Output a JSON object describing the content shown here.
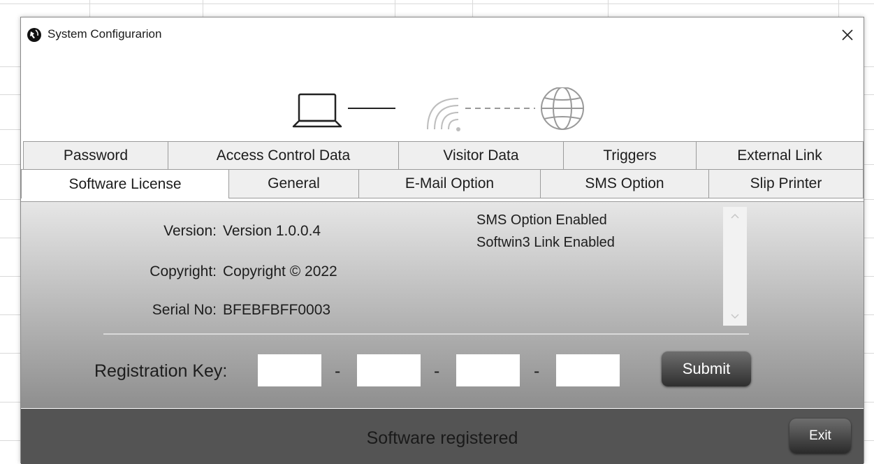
{
  "window": {
    "title": "System Configurarion",
    "icon": "globe-cursor-icon",
    "close_glyph": "✕"
  },
  "tabs_row1": [
    {
      "label": "Password"
    },
    {
      "label": "Access Control Data"
    },
    {
      "label": "Visitor Data"
    },
    {
      "label": "Triggers"
    },
    {
      "label": "External Link"
    }
  ],
  "tabs_row2": [
    {
      "label": "Software License",
      "active": true
    },
    {
      "label": "General"
    },
    {
      "label": "E-Mail Option"
    },
    {
      "label": "SMS Option"
    },
    {
      "label": "Slip Printer"
    }
  ],
  "license": {
    "version_label": "Version:",
    "version_value": "Version 1.0.0.4",
    "copyright_label": "Copyright:",
    "copyright_value": "Copyright ©  2022",
    "serial_label": "Serial No:",
    "serial_value": "BFEBFBFF0003",
    "options": [
      "SMS Option Enabled",
      "Softwin3 Link Enabled"
    ]
  },
  "registration": {
    "label": "Registration Key:",
    "separator": "-",
    "fields": [
      "",
      "",
      "",
      ""
    ],
    "submit_label": "Submit"
  },
  "status": {
    "text": "Software registered",
    "exit_label": "Exit"
  },
  "icons": [
    "laptop-icon",
    "wifi-icon",
    "globe-icon",
    "close-icon",
    "scroll-up-icon",
    "scroll-down-icon"
  ],
  "colors": {
    "panel_top": "#e6e6e6",
    "panel_bottom": "#8e8e8e",
    "status_bar": "#545454",
    "button": "#3a3a3a"
  }
}
